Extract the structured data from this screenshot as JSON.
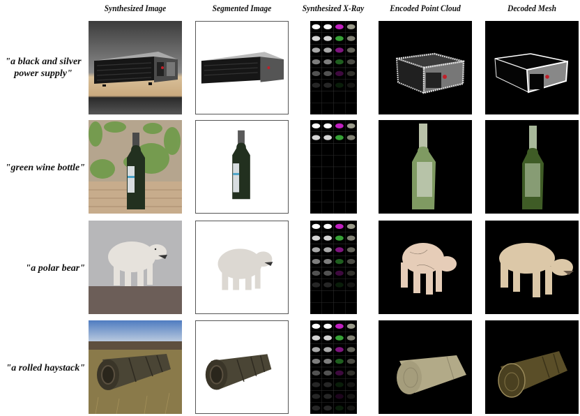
{
  "columns": [
    {
      "key": "synth",
      "label": "Synthesized Image"
    },
    {
      "key": "seg",
      "label": "Segmented Image"
    },
    {
      "key": "xray",
      "label": "Synthesized X-Ray"
    },
    {
      "key": "pc",
      "label": "Encoded Point Cloud"
    },
    {
      "key": "mesh",
      "label": "Decoded Mesh"
    }
  ],
  "rows": [
    {
      "prompt_line1": "\"a black and silver",
      "prompt_line2": "power supply\"",
      "object": "power-supply",
      "colors": {
        "object": "#1a1a1a",
        "trim": "#c8c8c8",
        "accent": "#c0202a",
        "bg_top": "#4a4a4a",
        "bg_bottom": "#d9bf9a"
      }
    },
    {
      "prompt_line1": "\"green wine bottle\"",
      "prompt_line2": "",
      "object": "wine-bottle",
      "colors": {
        "object": "#2a3a28",
        "label": "#d8dde0",
        "pc": "#8da870",
        "mesh": "#4a6a30",
        "wall": "#b5a58e",
        "plants": "#6a9a45",
        "floor": "#c7ac8c"
      }
    },
    {
      "prompt_line1": "\"a polar bear\"",
      "prompt_line2": "",
      "object": "polar-bear",
      "colors": {
        "object": "#e6e2dc",
        "sky": "#b7b7b9",
        "rock": "#6c5e58",
        "pc": "#e6cdb8",
        "mesh": "#dcc8a8"
      }
    },
    {
      "prompt_line1": "\"a rolled haystack\"",
      "prompt_line2": "",
      "object": "rolled-haystack",
      "colors": {
        "object": "#4a4535",
        "sky": "#5b86c8",
        "field": "#8a7a4a",
        "pc": "#b2aa88",
        "mesh": "#5a4e28"
      }
    }
  ],
  "xray_layers": [
    {
      "rows_filled": 6
    },
    {
      "rows_filled": 2
    },
    {
      "rows_filled": 6
    },
    {
      "rows_filled": 8
    }
  ]
}
